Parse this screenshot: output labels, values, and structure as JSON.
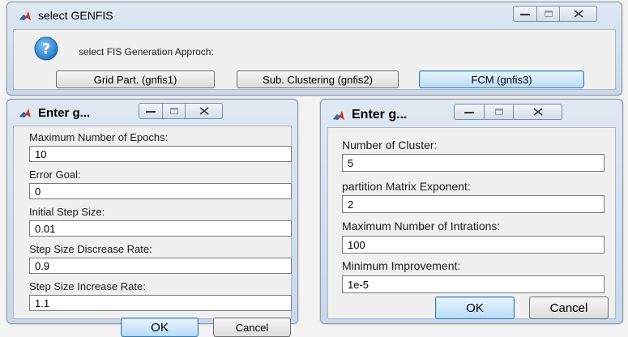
{
  "genfis_dialog": {
    "title": "select GENFIS",
    "prompt": "select FIS Generation Approch:",
    "buttons": [
      {
        "label": "Grid Part. (gnfis1)"
      },
      {
        "label": "Sub. Clustering (gnfis2)"
      },
      {
        "label": "FCM (gnfis3)"
      }
    ]
  },
  "grid_dialog": {
    "title": "Enter g...",
    "fields": [
      {
        "label": "Maximum Number of Epochs:",
        "value": "10"
      },
      {
        "label": "Error Goal:",
        "value": "0"
      },
      {
        "label": "Initial Step Size:",
        "value": "0.01"
      },
      {
        "label": "Step Size Discrease Rate:",
        "value": "0.9"
      },
      {
        "label": "Step Size Increase Rate:",
        "value": "1.1"
      }
    ],
    "ok_label": "OK",
    "cancel_label": "Cancel"
  },
  "fcm_dialog": {
    "title": "Enter g...",
    "fields": [
      {
        "label": "Number of Cluster:",
        "value": "5"
      },
      {
        "label": "partition Matrix Exponent:",
        "value": "2"
      },
      {
        "label": "Maximum Number of Intrations:",
        "value": "100"
      },
      {
        "label": "Minimum Improvement:",
        "value": "1e-5"
      }
    ],
    "ok_label": "OK",
    "cancel_label": "Cancel"
  }
}
